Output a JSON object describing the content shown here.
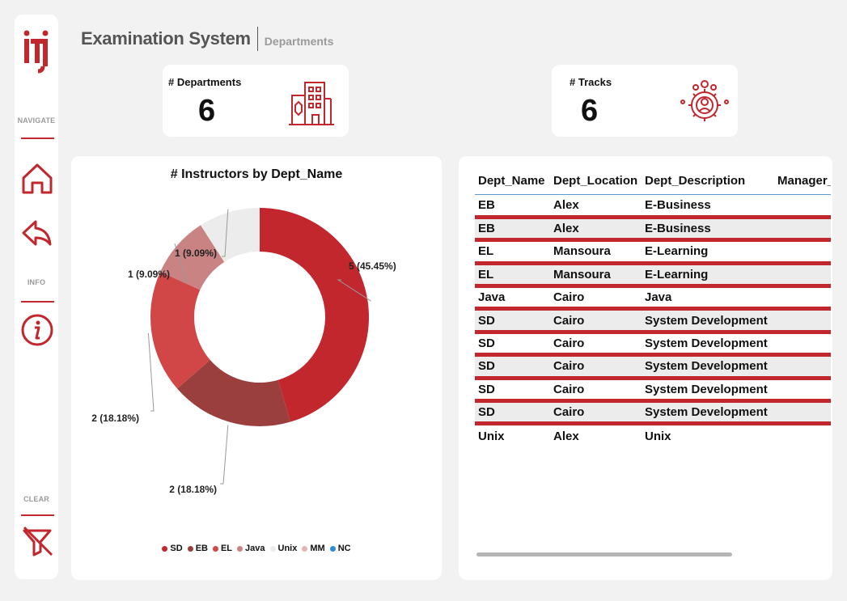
{
  "sidebar": {
    "navigate_label": "NAVIGATE",
    "info_label": "INFO",
    "clear_label": "CLEAR",
    "accent": "#c1272d",
    "icons": [
      "home-icon",
      "back-arrow-icon",
      "info-icon",
      "clear-filter-icon"
    ]
  },
  "header": {
    "title": "Examination System",
    "subtitle": "Departments"
  },
  "kpis": {
    "departments": {
      "label": "# Departments",
      "value": "6",
      "icon": "building-icon"
    },
    "tracks": {
      "label": "# Tracks",
      "value": "6",
      "icon": "team-gear-icon"
    }
  },
  "chart_data": {
    "type": "pie",
    "title": "# Instructors by Dept_Name",
    "donut": true,
    "series": [
      {
        "name": "SD",
        "value": 5,
        "label": "5 (45.45%)",
        "color": "#c1272d"
      },
      {
        "name": "EB",
        "value": 2,
        "label": "2 (18.18%)",
        "color": "#9a3e3e"
      },
      {
        "name": "EL",
        "value": 2,
        "label": "2 (18.18%)",
        "color": "#d14747"
      },
      {
        "name": "Java",
        "value": 1,
        "label": "1 (9.09%)",
        "color": "#c98383"
      },
      {
        "name": "Unix",
        "value": 1,
        "label": "1 (9.09%)",
        "color": "#ececec"
      }
    ],
    "legend": [
      {
        "name": "SD",
        "color": "#c1272d"
      },
      {
        "name": "EB",
        "color": "#9a3e3e"
      },
      {
        "name": "EL",
        "color": "#d14747"
      },
      {
        "name": "Java",
        "color": "#c98383"
      },
      {
        "name": "Unix",
        "color": "#ececec"
      },
      {
        "name": "MM",
        "color": "#e8b3b3"
      },
      {
        "name": "NC",
        "color": "#2e8bd6"
      }
    ],
    "legend_position": "bottom"
  },
  "table": {
    "columns": [
      "Dept_Name",
      "Dept_Location",
      "Dept_Description",
      "Manager_"
    ],
    "rows": [
      [
        "EB",
        "Alex",
        "E-Business",
        ""
      ],
      [
        "EB",
        "Alex",
        "E-Business",
        ""
      ],
      [
        "EL",
        "Mansoura",
        "E-Learning",
        ""
      ],
      [
        "EL",
        "Mansoura",
        "E-Learning",
        ""
      ],
      [
        "Java",
        "Cairo",
        "Java",
        ""
      ],
      [
        "SD",
        "Cairo",
        "System Development",
        ""
      ],
      [
        "SD",
        "Cairo",
        "System Development",
        ""
      ],
      [
        "SD",
        "Cairo",
        "System Development",
        ""
      ],
      [
        "SD",
        "Cairo",
        "System Development",
        ""
      ],
      [
        "SD",
        "Cairo",
        "System Development",
        ""
      ],
      [
        "Unix",
        "Alex",
        "Unix",
        ""
      ]
    ]
  }
}
